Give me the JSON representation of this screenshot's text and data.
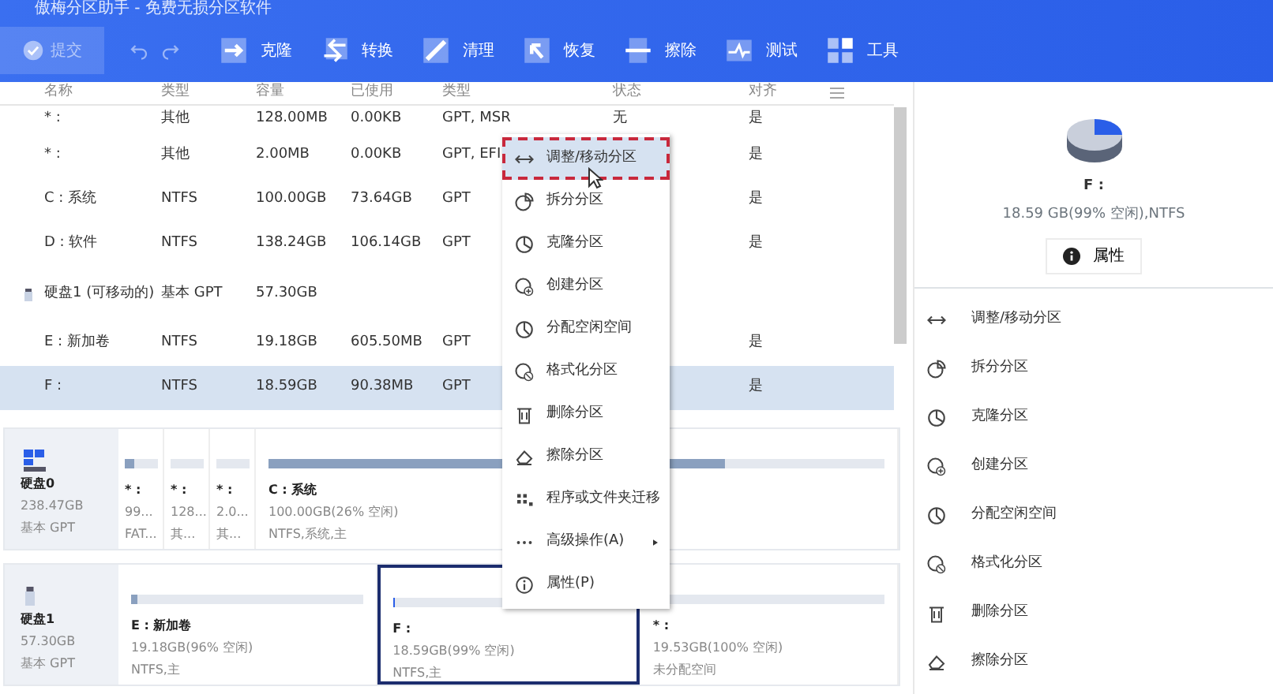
{
  "window": {
    "title": "傲梅分区助手 - 免费无损分区软件"
  },
  "toolbar": {
    "commit": {
      "label": "提交",
      "disabled": true
    },
    "items": [
      {
        "label": "克隆"
      },
      {
        "label": "转换"
      },
      {
        "label": "清理"
      },
      {
        "label": "恢复"
      },
      {
        "label": "擦除"
      },
      {
        "label": "测试"
      },
      {
        "label": "工具"
      }
    ]
  },
  "table": {
    "columns": [
      "名称",
      "类型",
      "容量",
      "已使用",
      "类型",
      "状态",
      "对齐"
    ],
    "rows": [
      {
        "kind": "partition",
        "selected": false,
        "cells": [
          "* :",
          "其他",
          "128.00MB",
          "0.00KB",
          "GPT, MSR",
          "无",
          "是"
        ]
      },
      {
        "kind": "partition",
        "selected": false,
        "cells": [
          "* :",
          "其他",
          "2.00MB",
          "0.00KB",
          "GPT, EFI",
          "",
          "是"
        ]
      },
      {
        "kind": "partition",
        "selected": false,
        "cells": [
          "C : 系统",
          "NTFS",
          "100.00GB",
          "73.64GB",
          "GPT",
          "",
          "是"
        ]
      },
      {
        "kind": "partition",
        "selected": false,
        "cells": [
          "D : 软件",
          "NTFS",
          "138.24GB",
          "106.14GB",
          "GPT",
          "",
          "是"
        ]
      },
      {
        "kind": "disk",
        "selected": false,
        "cells": [
          "硬盘1 (可移动的)",
          "基本 GPT",
          "57.30GB",
          "",
          "",
          "",
          ""
        ]
      },
      {
        "kind": "partition",
        "selected": false,
        "cells": [
          "E : 新加卷",
          "NTFS",
          "19.18GB",
          "605.50MB",
          "GPT",
          "",
          "是"
        ]
      },
      {
        "kind": "partition",
        "selected": true,
        "cells": [
          "F :",
          "NTFS",
          "18.59GB",
          "90.38MB",
          "GPT",
          "",
          "是"
        ]
      }
    ]
  },
  "disks": [
    {
      "name": "硬盘0",
      "size": "238.47GB",
      "type": "基本 GPT",
      "partitions": [
        {
          "kind": "small",
          "name": "* :",
          "size": "99...",
          "info": "FAT...",
          "level": 0.3,
          "selected": false
        },
        {
          "kind": "small",
          "name": "* :",
          "size": "128...",
          "info": "其...",
          "selected": false
        },
        {
          "kind": "small",
          "name": "* :",
          "size": "2.0...",
          "info": "其...",
          "selected": false
        },
        {
          "kind": "volume",
          "name": "C : 系统",
          "size": "100.00GB(26% 空闲)",
          "info": "NTFS,系统,主",
          "level": 0.74,
          "selected": false
        }
      ]
    },
    {
      "name": "硬盘1",
      "size": "57.30GB",
      "type": "基本 GPT",
      "partitions": [
        {
          "kind": "volume",
          "name": "E : 新加卷",
          "size": "19.18GB(96% 空闲)",
          "info": "NTFS,主",
          "level": 0.03,
          "selected": false
        },
        {
          "kind": "volume",
          "name": "F :",
          "size": "18.59GB(99% 空闲)",
          "info": "NTFS,主",
          "level": 0.01,
          "selected": true
        },
        {
          "kind": "volume",
          "name": "* :",
          "size": "19.53GB(100% 空闲)",
          "info": "未分配空间",
          "selected": false
        }
      ]
    }
  ],
  "context_menu": {
    "items": [
      {
        "label": "调整/移动分区",
        "selected": true
      },
      {
        "label": "拆分分区",
        "selected": false
      },
      {
        "label": "克隆分区",
        "selected": false
      },
      {
        "label": "创建分区",
        "selected": false
      },
      {
        "label": "分配空闲空间",
        "selected": false
      },
      {
        "label": "格式化分区",
        "selected": false
      },
      {
        "label": "删除分区",
        "selected": false
      },
      {
        "label": "擦除分区",
        "selected": false
      },
      {
        "label": "程序或文件夹迁移",
        "selected": false
      },
      {
        "label": "高级操作(A)",
        "selected": false,
        "submenu": true
      },
      {
        "label": "属性(P)",
        "selected": false
      }
    ]
  },
  "side_panel": {
    "name": "F :",
    "info": "18.59 GB(99% 空闲),NTFS",
    "properties_button": "属性",
    "actions": [
      "调整/移动分区",
      "拆分分区",
      "克隆分区",
      "创建分区",
      "分配空闲空间",
      "格式化分区",
      "删除分区",
      "擦除分区"
    ]
  }
}
